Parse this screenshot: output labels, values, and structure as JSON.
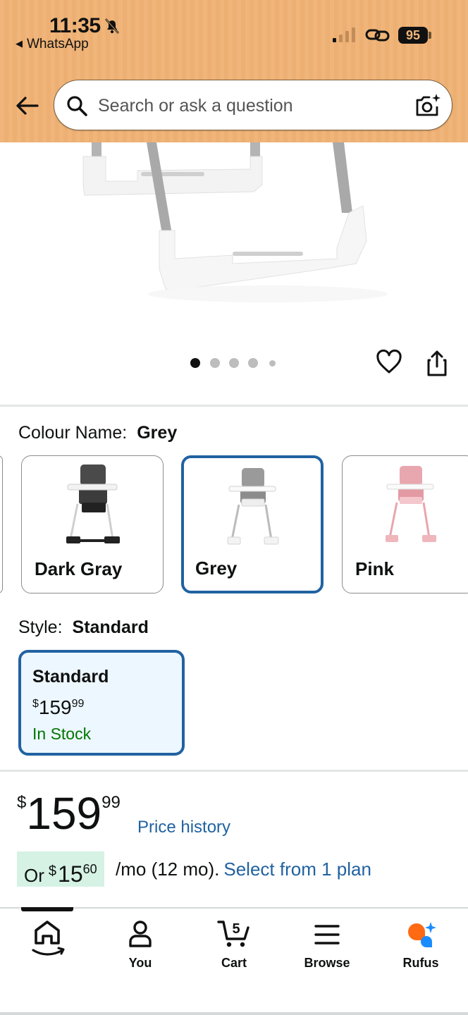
{
  "status_bar": {
    "time": "11:35",
    "back_app": "WhatsApp",
    "battery": "95"
  },
  "search": {
    "placeholder": "Search or ask a question"
  },
  "carousel": {
    "dots": 5,
    "active_index": 0
  },
  "colour": {
    "label": "Colour Name:",
    "selected": "Grey",
    "options": [
      {
        "name": "Dark Gray",
        "seat_color": "#4a4a4a",
        "frame_color": "#222222"
      },
      {
        "name": "Grey",
        "seat_color": "#9a9a9a",
        "frame_color": "#dddddd"
      },
      {
        "name": "Pink",
        "seat_color": "#e8a6ae",
        "frame_color": "#e8a6ae"
      }
    ]
  },
  "style": {
    "label": "Style:",
    "selected": "Standard",
    "option": {
      "title": "Standard",
      "currency": "$",
      "dollars": "159",
      "cents": "99",
      "stock": "In Stock"
    }
  },
  "price": {
    "currency": "$",
    "dollars": "159",
    "cents": "99",
    "history_link": "Price history"
  },
  "installment": {
    "prefix": "Or",
    "currency": "$",
    "dollars": "15",
    "cents": "60",
    "term": "/mo (12 mo).",
    "link": "Select from 1 plan"
  },
  "nav": {
    "items": [
      {
        "label": "",
        "icon": "home-icon"
      },
      {
        "label": "You",
        "icon": "person-icon"
      },
      {
        "label": "Cart",
        "icon": "cart-icon",
        "badge": "5"
      },
      {
        "label": "Browse",
        "icon": "menu-icon"
      },
      {
        "label": "Rufus",
        "icon": "rufus-icon"
      }
    ]
  },
  "colors": {
    "header_bg": "#f0b57a",
    "link": "#2162a1",
    "selected_border": "#2162a1",
    "in_stock": "#007600",
    "installment_bg": "#d5f2e4"
  }
}
